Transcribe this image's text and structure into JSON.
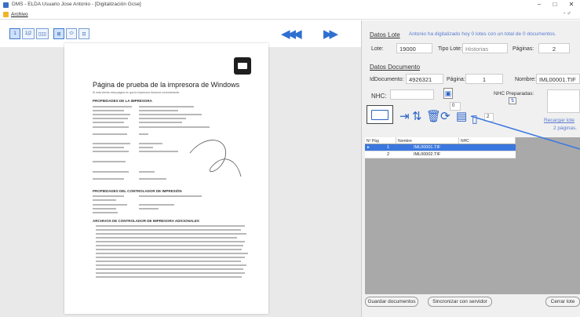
{
  "window": {
    "title": "DMS - ELDA Usuario Jose Antonio - [Digitalización Gcse]",
    "minimize": "–",
    "maximize": "□",
    "close": "✕"
  },
  "menu": {
    "archivo": "Archivo",
    "mdi_restore": "- ♂"
  },
  "toolbar": {
    "view1": "1",
    "view2": "1|2",
    "view3": "▯▯▯",
    "fit1": "⊞",
    "fit2": "⬭",
    "fit3": "⊡",
    "nav_prev": "◀◀◀",
    "nav_next": "▶▶"
  },
  "document": {
    "title": "Página de prueba de la impresora de Windows",
    "subtitle": "Si está viendo esta página es que la impresora funciona correctamente.",
    "section1": "PROPIEDADES DE LA IMPRESORA",
    "section2": "PROPIEDADES DEL CONTROLADOR DE IMPRESIÓN",
    "section3": "ARCHIVOS DE CONTROLADOR DE IMPRESORA ADICIONALES"
  },
  "lote": {
    "header": "Datos Lote",
    "info": "Antonio ha digitalizado hoy 0 lotes con un total de 0 documentos.",
    "lote_label": "Lote:",
    "lote_value": "19000",
    "tipo_label": "Tipo Lote:",
    "tipo_value": "Historias",
    "paginas_label": "Páginas:",
    "paginas_value": "2"
  },
  "documento": {
    "header": "Datos Documento",
    "id_label": "IdDocumento:",
    "id_value": "4926321",
    "pagina_label": "Página:",
    "pagina_value": "1",
    "nombre_label": "Nombre:",
    "nombre_value": "IML00001.TIF",
    "nhc_label": "NHC:",
    "nhc_value": "",
    "stepper_value": "0",
    "nhc_preparadas_label": "NHC Preparadas:",
    "count_value": "2",
    "recargar_label": "Recargar lote",
    "paginas_info": "2 páginas."
  },
  "grid": {
    "columns": [
      "Nº Pág",
      "Nombre",
      "NHC"
    ],
    "rows": [
      {
        "pag": "1",
        "nombre": "IML00001.TIF",
        "nhc": ""
      },
      {
        "pag": "2",
        "nombre": "IML00002.TIF",
        "nhc": ""
      }
    ]
  },
  "buttons": {
    "guardar": "Guardar documentos",
    "sincronizar": "Sincronizar con servidor",
    "cerrar": "Cerrar lote"
  },
  "colors": {
    "accent": "#2b63c8",
    "selection": "#3a78e0",
    "info_text": "#5a7bd0"
  }
}
